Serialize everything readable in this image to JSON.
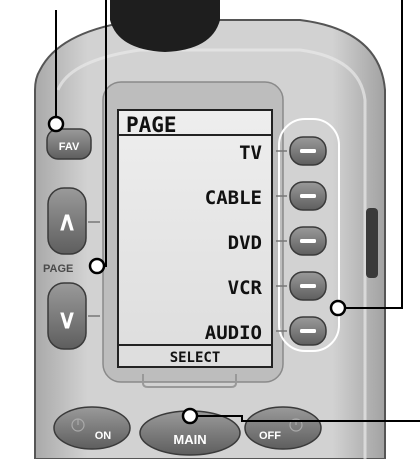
{
  "lcd": {
    "header": "PAGE",
    "items": [
      "TV",
      "CABLE",
      "DVD",
      "VCR",
      "AUDIO"
    ],
    "footer": "SELECT"
  },
  "buttons": {
    "fav": "FAV",
    "page_label": "PAGE",
    "page_up_glyph": "∧",
    "page_down_glyph": "∨",
    "on": "ON",
    "main": "MAIN",
    "off": "OFF"
  },
  "colors": {
    "body": "#c9c9c9",
    "button": "#7b7b7b",
    "lcd": "#e6e6e6",
    "callout": "#000000"
  }
}
